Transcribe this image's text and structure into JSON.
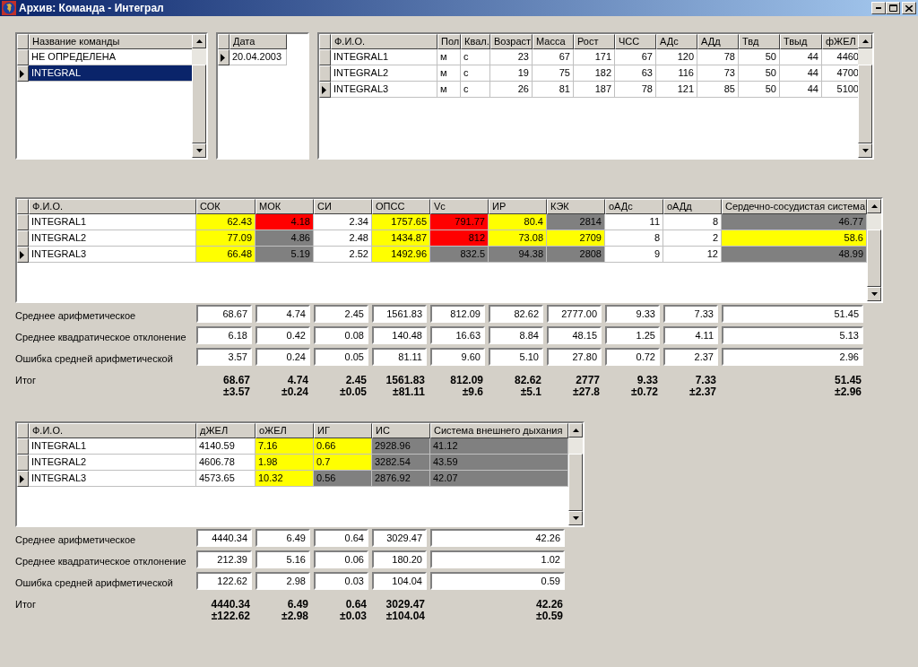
{
  "window": {
    "title": "Архив: Команда - Интеграл"
  },
  "teams": {
    "columns": [
      "Название команды"
    ],
    "rows": [
      {
        "cells": [
          "НЕ ОПРЕДЕЛЕНА"
        ],
        "selected": false
      },
      {
        "cells": [
          "INTEGRAL"
        ],
        "selected": true
      }
    ]
  },
  "dates": {
    "columns": [
      "Дата"
    ],
    "rows": [
      {
        "cells": [
          "20.04.2003"
        ],
        "selected": true
      }
    ]
  },
  "athletes": {
    "columns": [
      "Ф.И.О.",
      "Пол",
      "Квал.",
      "Возраст",
      "Масса",
      "Рост",
      "ЧСС",
      "АДс",
      "АДд",
      "Твд",
      "Твыд",
      "фЖЕЛ"
    ],
    "rows": [
      {
        "cells": [
          "INTEGRAL1",
          "м",
          "с",
          "23",
          "67",
          "171",
          "67",
          "120",
          "78",
          "50",
          "44",
          "4460"
        ],
        "selected": false
      },
      {
        "cells": [
          "INTEGRAL2",
          "м",
          "с",
          "19",
          "75",
          "182",
          "63",
          "116",
          "73",
          "50",
          "44",
          "4700"
        ],
        "selected": false
      },
      {
        "cells": [
          "INTEGRAL3",
          "м",
          "с",
          "26",
          "81",
          "187",
          "78",
          "121",
          "85",
          "50",
          "44",
          "5100"
        ],
        "selected": true
      }
    ]
  },
  "cardio": {
    "columns": [
      "Ф.И.О.",
      "СОК",
      "МОК",
      "СИ",
      "ОПСС",
      "Vc",
      "ИР",
      "КЭК",
      "оАДс",
      "оАДд",
      "Сердечно-сосудистая система"
    ],
    "rows": [
      {
        "selected": false,
        "cells": [
          {
            "text": "INTEGRAL1"
          },
          {
            "text": "62.43",
            "color": "#ffff00"
          },
          {
            "text": "4.18",
            "color": "#ff0000"
          },
          {
            "text": "2.34",
            "color": "#ffffff"
          },
          {
            "text": "1757.65",
            "color": "#ffff00"
          },
          {
            "text": "791.77",
            "color": "#ff0000"
          },
          {
            "text": "80.4",
            "color": "#ffff00"
          },
          {
            "text": "2814",
            "color": "#808080"
          },
          {
            "text": "11",
            "color": "#ffffff"
          },
          {
            "text": "8",
            "color": "#ffffff"
          },
          {
            "text": "46.77",
            "color": "#808080"
          }
        ]
      },
      {
        "selected": false,
        "cells": [
          {
            "text": "INTEGRAL2"
          },
          {
            "text": "77.09",
            "color": "#ffff00"
          },
          {
            "text": "4.86",
            "color": "#808080"
          },
          {
            "text": "2.48",
            "color": "#ffffff"
          },
          {
            "text": "1434.87",
            "color": "#ffff00"
          },
          {
            "text": "812",
            "color": "#ff0000"
          },
          {
            "text": "73.08",
            "color": "#ffff00"
          },
          {
            "text": "2709",
            "color": "#ffff00"
          },
          {
            "text": "8",
            "color": "#ffffff"
          },
          {
            "text": "2",
            "color": "#ffffff"
          },
          {
            "text": "58.6",
            "color": "#ffff00"
          }
        ]
      },
      {
        "selected": true,
        "cells": [
          {
            "text": "INTEGRAL3"
          },
          {
            "text": "66.48",
            "color": "#ffff00"
          },
          {
            "text": "5.19",
            "color": "#808080"
          },
          {
            "text": "2.52",
            "color": "#ffffff"
          },
          {
            "text": "1492.96",
            "color": "#ffff00"
          },
          {
            "text": "832.5",
            "color": "#808080"
          },
          {
            "text": "94.38",
            "color": "#808080"
          },
          {
            "text": "2808",
            "color": "#808080"
          },
          {
            "text": "9",
            "color": "#ffffff"
          },
          {
            "text": "12",
            "color": "#ffffff"
          },
          {
            "text": "48.99",
            "color": "#808080"
          }
        ]
      }
    ],
    "stats": [
      {
        "label": "Среднее арифметическое",
        "values": [
          "68.67",
          "4.74",
          "2.45",
          "1561.83",
          "812.09",
          "82.62",
          "2777.00",
          "9.33",
          "7.33",
          "51.45"
        ]
      },
      {
        "label": "Среднее квадратическое отклонение",
        "values": [
          "6.18",
          "0.42",
          "0.08",
          "140.48",
          "16.63",
          "8.84",
          "48.15",
          "1.25",
          "4.11",
          "5.13"
        ]
      },
      {
        "label": "Ошибка средней арифметической",
        "values": [
          "3.57",
          "0.24",
          "0.05",
          "81.11",
          "9.60",
          "5.10",
          "27.80",
          "0.72",
          "2.37",
          "2.96"
        ]
      }
    ],
    "total": {
      "label": "Итог",
      "values": [
        {
          "mean": "68.67",
          "error": "±3.57"
        },
        {
          "mean": "4.74",
          "error": "±0.24"
        },
        {
          "mean": "2.45",
          "error": "±0.05"
        },
        {
          "mean": "1561.83",
          "error": "±81.11"
        },
        {
          "mean": "812.09",
          "error": "±9.6"
        },
        {
          "mean": "82.62",
          "error": "±5.1"
        },
        {
          "mean": "2777",
          "error": "±27.8"
        },
        {
          "mean": "9.33",
          "error": "±0.72"
        },
        {
          "mean": "7.33",
          "error": "±2.37"
        },
        {
          "mean": "51.45",
          "error": "±2.96"
        }
      ]
    }
  },
  "respiratory": {
    "columns": [
      "Ф.И.О.",
      "дЖЕЛ",
      "оЖЕЛ",
      "ИГ",
      "ИС",
      "Система внешнего дыхания"
    ],
    "rows": [
      {
        "selected": false,
        "cells": [
          {
            "text": "INTEGRAL1"
          },
          {
            "text": "4140.59",
            "color": "#ffffff"
          },
          {
            "text": "7.16",
            "color": "#ffff00"
          },
          {
            "text": "0.66",
            "color": "#ffff00"
          },
          {
            "text": "2928.96",
            "color": "#808080"
          },
          {
            "text": "41.12",
            "color": "#808080"
          }
        ]
      },
      {
        "selected": false,
        "cells": [
          {
            "text": "INTEGRAL2"
          },
          {
            "text": "4606.78",
            "color": "#ffffff"
          },
          {
            "text": "1.98",
            "color": "#ffff00"
          },
          {
            "text": "0.7",
            "color": "#ffff00"
          },
          {
            "text": "3282.54",
            "color": "#808080"
          },
          {
            "text": "43.59",
            "color": "#808080"
          }
        ]
      },
      {
        "selected": true,
        "cells": [
          {
            "text": "INTEGRAL3"
          },
          {
            "text": "4573.65",
            "color": "#ffffff"
          },
          {
            "text": "10.32",
            "color": "#ffff00"
          },
          {
            "text": "0.56",
            "color": "#808080"
          },
          {
            "text": "2876.92",
            "color": "#808080"
          },
          {
            "text": "42.07",
            "color": "#808080"
          }
        ]
      }
    ],
    "stats": [
      {
        "label": "Среднее арифметическое",
        "values": [
          "4440.34",
          "6.49",
          "0.64",
          "3029.47",
          "42.26"
        ]
      },
      {
        "label": "Среднее квадратическое отклонение",
        "values": [
          "212.39",
          "5.16",
          "0.06",
          "180.20",
          "1.02"
        ]
      },
      {
        "label": "Ошибка средней арифметической",
        "values": [
          "122.62",
          "2.98",
          "0.03",
          "104.04",
          "0.59"
        ]
      }
    ],
    "total": {
      "label": "Итог",
      "values": [
        {
          "mean": "4440.34",
          "error": "±122.62"
        },
        {
          "mean": "6.49",
          "error": "±2.98"
        },
        {
          "mean": "0.64",
          "error": "±0.03"
        },
        {
          "mean": "3029.47",
          "error": "±104.04"
        },
        {
          "mean": "42.26",
          "error": "±0.59"
        }
      ]
    }
  }
}
